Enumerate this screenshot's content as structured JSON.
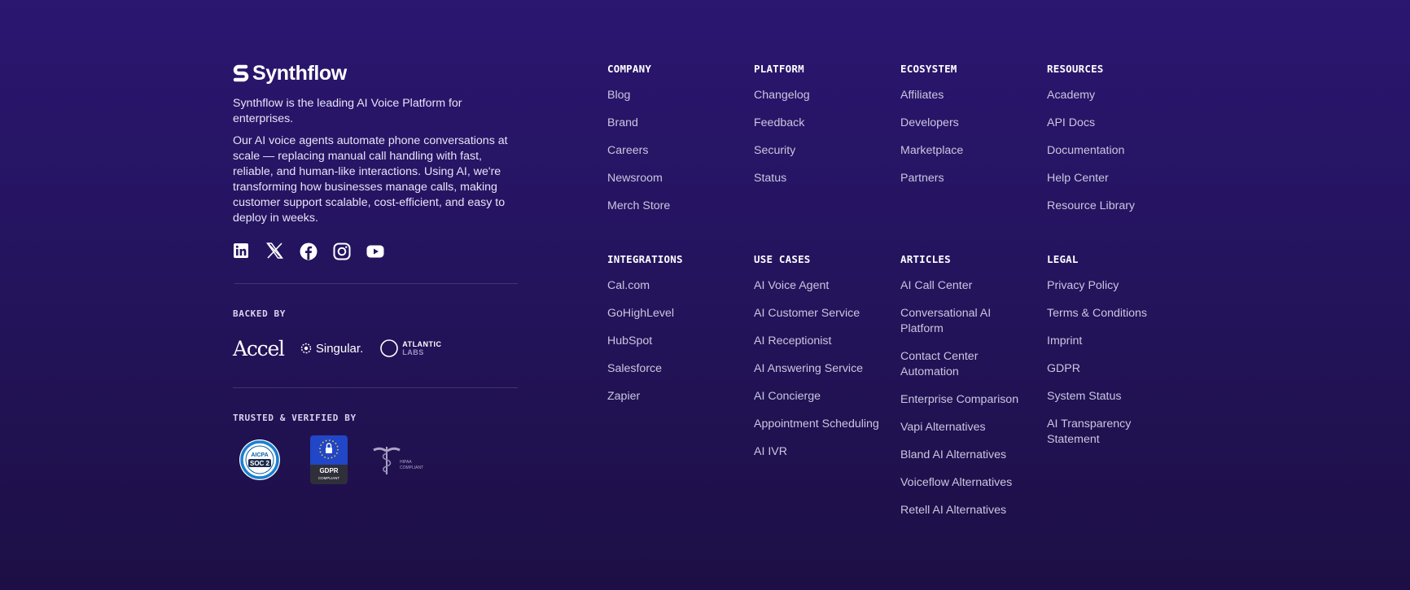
{
  "brand": {
    "name": "Synthflow",
    "tagline": "Synthflow is the leading AI Voice Platform for enterprises.",
    "description": "Our AI voice agents automate phone conversations at scale — replacing manual call handling with fast, reliable, and human-like interactions. Using AI, we're transforming how businesses manage calls, making customer support scalable, cost-efficient, and easy to deploy in weeks."
  },
  "social": [
    "linkedin-icon",
    "x-icon",
    "facebook-icon",
    "instagram-icon",
    "youtube-icon"
  ],
  "backed_by": {
    "title": "BACKED BY",
    "investors": {
      "accel": "Accel",
      "singular": "Singular.",
      "atlantic_line1": "ATLANTIC",
      "atlantic_line2": "LABS"
    }
  },
  "trusted": {
    "title": "TRUSTED & VERIFIED BY",
    "soc": {
      "line1": "AICPA",
      "line2": "SOC 2"
    },
    "gdpr": {
      "line1": "GDPR",
      "line2": "COMPLIANT"
    },
    "hipaa": {
      "line1": "HIPAA",
      "line2": "COMPLIANT"
    }
  },
  "columns": [
    {
      "title": "COMPANY",
      "links": [
        "Blog",
        "Brand",
        "Careers",
        "Newsroom",
        "Merch Store"
      ]
    },
    {
      "title": "PLATFORM",
      "links": [
        "Changelog",
        "Feedback",
        "Security",
        "Status"
      ]
    },
    {
      "title": "ECOSYSTEM",
      "links": [
        "Affiliates",
        "Developers",
        "Marketplace",
        "Partners"
      ]
    },
    {
      "title": "RESOURCES",
      "links": [
        "Academy",
        "API Docs",
        "Documentation",
        "Help Center",
        "Resource Library"
      ]
    },
    {
      "title": "INTEGRATIONS",
      "links": [
        "Cal.com",
        "GoHighLevel",
        "HubSpot",
        "Salesforce",
        "Zapier"
      ]
    },
    {
      "title": "USE CASES",
      "links": [
        "AI Voice Agent",
        "AI Customer Service",
        "AI Receptionist",
        "AI Answering Service",
        "AI Concierge",
        "Appointment Scheduling",
        "AI IVR"
      ]
    },
    {
      "title": "ARTICLES",
      "links": [
        "AI Call Center",
        "Conversational AI Platform",
        "Contact Center Automation",
        "Enterprise Comparison",
        "Vapi Alternatives",
        "Bland AI Alternatives",
        "Voiceflow Alternatives",
        "Retell AI Alternatives"
      ]
    },
    {
      "title": "LEGAL",
      "links": [
        "Privacy Policy",
        "Terms & Conditions",
        "Imprint",
        "GDPR",
        "System Status",
        "AI Transparency Statement"
      ]
    }
  ],
  "colors": {
    "background": "#24145e",
    "link": "#cbc6df",
    "heading": "#ffffff"
  }
}
